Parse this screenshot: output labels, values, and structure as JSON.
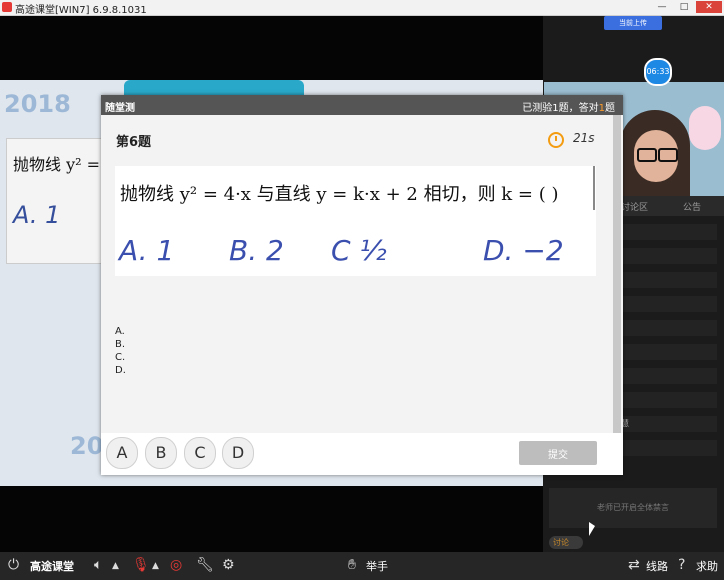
{
  "window": {
    "title": "高途课堂[WIN7] 6.9.8.1031",
    "controls": [
      "—",
      "□",
      "✕"
    ]
  },
  "slide": {
    "year_top": "2018",
    "year_bottom": "20",
    "fragment_text": "抛物线 y² =",
    "fragment_hand": "A. 1"
  },
  "right_panel": {
    "live_upload": "当前上传",
    "time_badge": "06:33",
    "tabs": [
      "讨论区",
      "公告"
    ],
    "partial_text": "慧",
    "mute_notice": "老师已开启全体禁言",
    "discuss_toggle": "讨论"
  },
  "quiz": {
    "header_title": "随堂测",
    "stats_prefix": "已测验",
    "stats_count": "1",
    "stats_mid": "题，答对",
    "stats_correct": "1",
    "stats_suffix": "题",
    "question_number": "第6题",
    "timer": "21s",
    "question_text": "抛物线 y² = 4·x 与直线 y = k·x + 2 相切，则 k = (      )",
    "handwritten": [
      "A. 1",
      "B. 2",
      "C ½",
      "D. −2"
    ],
    "option_lines": [
      "A.",
      "B.",
      "C.",
      "D."
    ],
    "option_buttons": [
      "A",
      "B",
      "C",
      "D"
    ],
    "submit_label": "提交"
  },
  "taskbar": {
    "brand": "高途课堂",
    "raise_hand": "举手",
    "route": "线路",
    "help": "求助"
  },
  "colors": {
    "accent_blue": "#1e88e5",
    "orange_highlight": "#ff9c2a",
    "handwriting_blue": "#3b4fae"
  }
}
